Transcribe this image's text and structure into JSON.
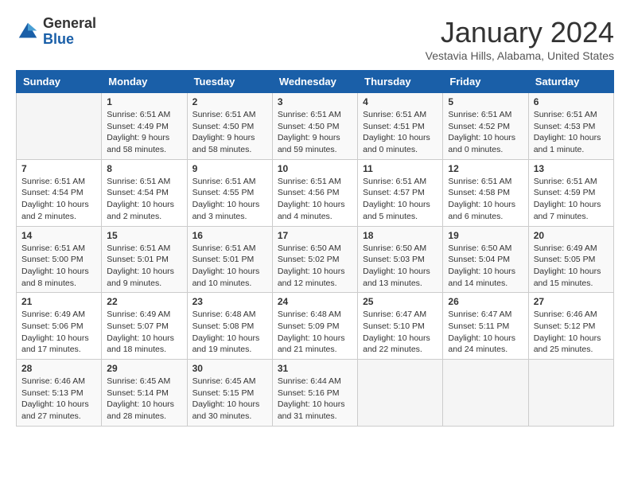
{
  "header": {
    "logo_general": "General",
    "logo_blue": "Blue",
    "title": "January 2024",
    "location": "Vestavia Hills, Alabama, United States"
  },
  "days_of_week": [
    "Sunday",
    "Monday",
    "Tuesday",
    "Wednesday",
    "Thursday",
    "Friday",
    "Saturday"
  ],
  "weeks": [
    [
      {
        "day": "",
        "info": ""
      },
      {
        "day": "1",
        "info": "Sunrise: 6:51 AM\nSunset: 4:49 PM\nDaylight: 9 hours\nand 58 minutes."
      },
      {
        "day": "2",
        "info": "Sunrise: 6:51 AM\nSunset: 4:50 PM\nDaylight: 9 hours\nand 58 minutes."
      },
      {
        "day": "3",
        "info": "Sunrise: 6:51 AM\nSunset: 4:50 PM\nDaylight: 9 hours\nand 59 minutes."
      },
      {
        "day": "4",
        "info": "Sunrise: 6:51 AM\nSunset: 4:51 PM\nDaylight: 10 hours\nand 0 minutes."
      },
      {
        "day": "5",
        "info": "Sunrise: 6:51 AM\nSunset: 4:52 PM\nDaylight: 10 hours\nand 0 minutes."
      },
      {
        "day": "6",
        "info": "Sunrise: 6:51 AM\nSunset: 4:53 PM\nDaylight: 10 hours\nand 1 minute."
      }
    ],
    [
      {
        "day": "7",
        "info": "Sunrise: 6:51 AM\nSunset: 4:54 PM\nDaylight: 10 hours\nand 2 minutes."
      },
      {
        "day": "8",
        "info": "Sunrise: 6:51 AM\nSunset: 4:54 PM\nDaylight: 10 hours\nand 2 minutes."
      },
      {
        "day": "9",
        "info": "Sunrise: 6:51 AM\nSunset: 4:55 PM\nDaylight: 10 hours\nand 3 minutes."
      },
      {
        "day": "10",
        "info": "Sunrise: 6:51 AM\nSunset: 4:56 PM\nDaylight: 10 hours\nand 4 minutes."
      },
      {
        "day": "11",
        "info": "Sunrise: 6:51 AM\nSunset: 4:57 PM\nDaylight: 10 hours\nand 5 minutes."
      },
      {
        "day": "12",
        "info": "Sunrise: 6:51 AM\nSunset: 4:58 PM\nDaylight: 10 hours\nand 6 minutes."
      },
      {
        "day": "13",
        "info": "Sunrise: 6:51 AM\nSunset: 4:59 PM\nDaylight: 10 hours\nand 7 minutes."
      }
    ],
    [
      {
        "day": "14",
        "info": "Sunrise: 6:51 AM\nSunset: 5:00 PM\nDaylight: 10 hours\nand 8 minutes."
      },
      {
        "day": "15",
        "info": "Sunrise: 6:51 AM\nSunset: 5:01 PM\nDaylight: 10 hours\nand 9 minutes."
      },
      {
        "day": "16",
        "info": "Sunrise: 6:51 AM\nSunset: 5:01 PM\nDaylight: 10 hours\nand 10 minutes."
      },
      {
        "day": "17",
        "info": "Sunrise: 6:50 AM\nSunset: 5:02 PM\nDaylight: 10 hours\nand 12 minutes."
      },
      {
        "day": "18",
        "info": "Sunrise: 6:50 AM\nSunset: 5:03 PM\nDaylight: 10 hours\nand 13 minutes."
      },
      {
        "day": "19",
        "info": "Sunrise: 6:50 AM\nSunset: 5:04 PM\nDaylight: 10 hours\nand 14 minutes."
      },
      {
        "day": "20",
        "info": "Sunrise: 6:49 AM\nSunset: 5:05 PM\nDaylight: 10 hours\nand 15 minutes."
      }
    ],
    [
      {
        "day": "21",
        "info": "Sunrise: 6:49 AM\nSunset: 5:06 PM\nDaylight: 10 hours\nand 17 minutes."
      },
      {
        "day": "22",
        "info": "Sunrise: 6:49 AM\nSunset: 5:07 PM\nDaylight: 10 hours\nand 18 minutes."
      },
      {
        "day": "23",
        "info": "Sunrise: 6:48 AM\nSunset: 5:08 PM\nDaylight: 10 hours\nand 19 minutes."
      },
      {
        "day": "24",
        "info": "Sunrise: 6:48 AM\nSunset: 5:09 PM\nDaylight: 10 hours\nand 21 minutes."
      },
      {
        "day": "25",
        "info": "Sunrise: 6:47 AM\nSunset: 5:10 PM\nDaylight: 10 hours\nand 22 minutes."
      },
      {
        "day": "26",
        "info": "Sunrise: 6:47 AM\nSunset: 5:11 PM\nDaylight: 10 hours\nand 24 minutes."
      },
      {
        "day": "27",
        "info": "Sunrise: 6:46 AM\nSunset: 5:12 PM\nDaylight: 10 hours\nand 25 minutes."
      }
    ],
    [
      {
        "day": "28",
        "info": "Sunrise: 6:46 AM\nSunset: 5:13 PM\nDaylight: 10 hours\nand 27 minutes."
      },
      {
        "day": "29",
        "info": "Sunrise: 6:45 AM\nSunset: 5:14 PM\nDaylight: 10 hours\nand 28 minutes."
      },
      {
        "day": "30",
        "info": "Sunrise: 6:45 AM\nSunset: 5:15 PM\nDaylight: 10 hours\nand 30 minutes."
      },
      {
        "day": "31",
        "info": "Sunrise: 6:44 AM\nSunset: 5:16 PM\nDaylight: 10 hours\nand 31 minutes."
      },
      {
        "day": "",
        "info": ""
      },
      {
        "day": "",
        "info": ""
      },
      {
        "day": "",
        "info": ""
      }
    ]
  ]
}
